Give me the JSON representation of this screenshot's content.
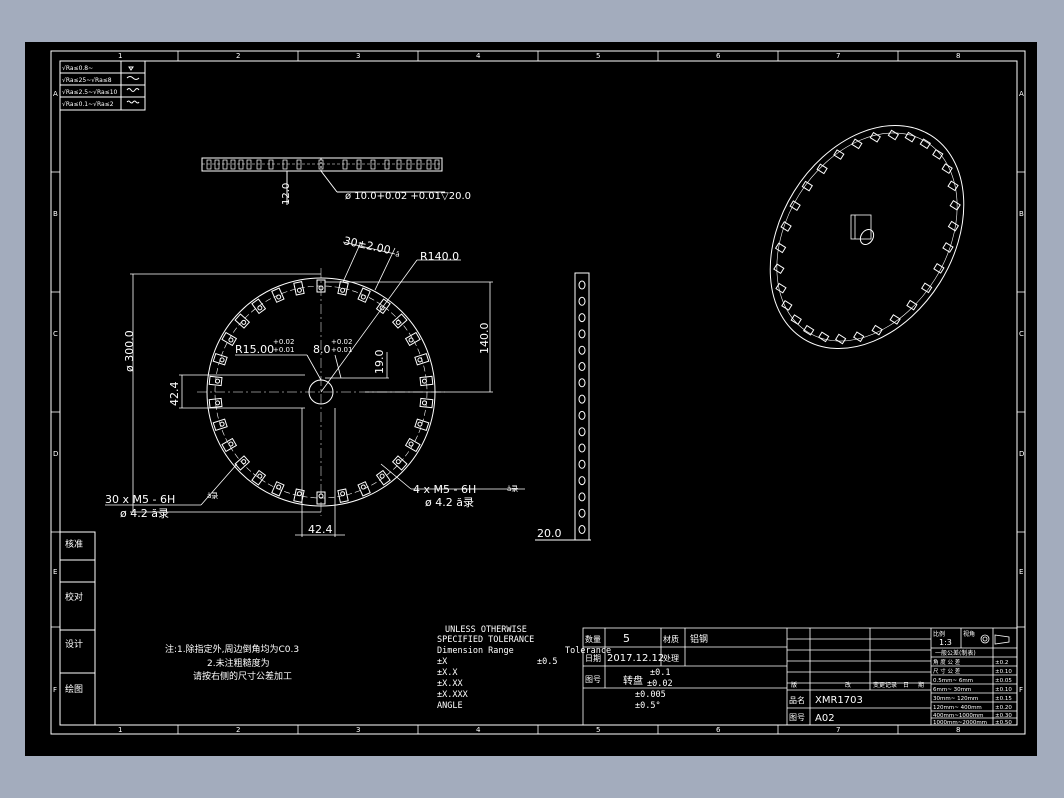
{
  "zone_numbers": [
    "1",
    "2",
    "3",
    "4",
    "5",
    "6",
    "7",
    "8"
  ],
  "zone_letters": [
    "A",
    "B",
    "C",
    "D",
    "E",
    "F"
  ],
  "roughness_legend": [
    "√Ra≤0.8~",
    "√Ra≤25~√Ra≤8",
    "√Ra≤2.5~√Ra≤10",
    "√Ra≤0.1~√Ra≤2"
  ],
  "top_view": {
    "height_dim": "12.0",
    "bore_dim": "ø 10.0+0.02 +0.01▽20.0"
  },
  "front_view": {
    "slot_dim": "30±2.00",
    "slot_angle": "ă",
    "radius_dim": "R140.0",
    "diameter_dim": "ø 300.0",
    "height_dim": "140.0",
    "hub_radius_dim": "R15.00",
    "hub_tol_upper": "+0.02",
    "hub_tol_lower": "+0.01",
    "key_width_dim": "8.0",
    "key_tol_upper": "+0.02",
    "key_tol_lower": "+0.01",
    "key_depth_dim": "19.0",
    "offset_dim_left": "42.4",
    "offset_dim_bottom": "42.4",
    "hole_callout_1": "30 x   M5 - 6H",
    "hole_callout_1_depth": "ă录",
    "hole_callout_1_drill": "ø   4.2 ă录",
    "hole_callout_2": "4 x   M5 - 6H",
    "hole_callout_2_depth": "ă录",
    "hole_callout_2_drill": "ø   4.2 ă录"
  },
  "side_view": {
    "thickness_dim": "20.0"
  },
  "left_stamps": [
    "核准",
    "校对",
    "设计",
    "绘图"
  ],
  "notes": [
    "注:1.除指定外,周边倒角均为C0.3",
    "2.未注粗糙度为",
    "请按右侧的尺寸公差加工"
  ],
  "tolerance_block": {
    "title": [
      "UNLESS OTHERWISE",
      "SPECIFIED TOLERANCE"
    ],
    "header_left": "Dimension Range",
    "header_right": "Tolerance",
    "rows": [
      "±X",
      "±X.X",
      "±X.XX",
      "±X.XXX",
      "ANGLE"
    ],
    "values": [
      "±0.5",
      "±0.1",
      "±0.02",
      "±0.005",
      "±0.5°"
    ]
  },
  "title_block": {
    "qty_label": "数量",
    "qty_value": "5",
    "material_label": "材质",
    "material_value": "铝钢",
    "date_label": "日期",
    "date_value": "2017.12.12",
    "process_label": "处理",
    "view_label": "图号",
    "view_value": "转盘",
    "name_label": "品名",
    "name_value": "XMR1703",
    "number_label": "图号",
    "number_value": "A02",
    "rev_labels": [
      "版",
      "改",
      "变更记录",
      "日",
      "期"
    ],
    "scale_label": "比例",
    "scale_value": "1:3",
    "projection_label": "视角",
    "general_tol_title": "一般公差(制表)",
    "general_tol_rows": [
      {
        "range": "角  度  公  差",
        "tol": "±0.2"
      },
      {
        "range": "尺  寸  公  差",
        "tol": "±0.10"
      },
      {
        "range": "0.5mm~   6mm",
        "tol": "±0.05"
      },
      {
        "range": "6mm~   30mm",
        "tol": "±0.10"
      },
      {
        "range": "30mm~  120mm",
        "tol": "±0.15"
      },
      {
        "range": "120mm~  400mm",
        "tol": "±0.20"
      },
      {
        "range": "400mm~1000mm",
        "tol": "±0.30"
      },
      {
        "range": "1000mm~2000mm",
        "tol": "±0.50"
      }
    ]
  }
}
